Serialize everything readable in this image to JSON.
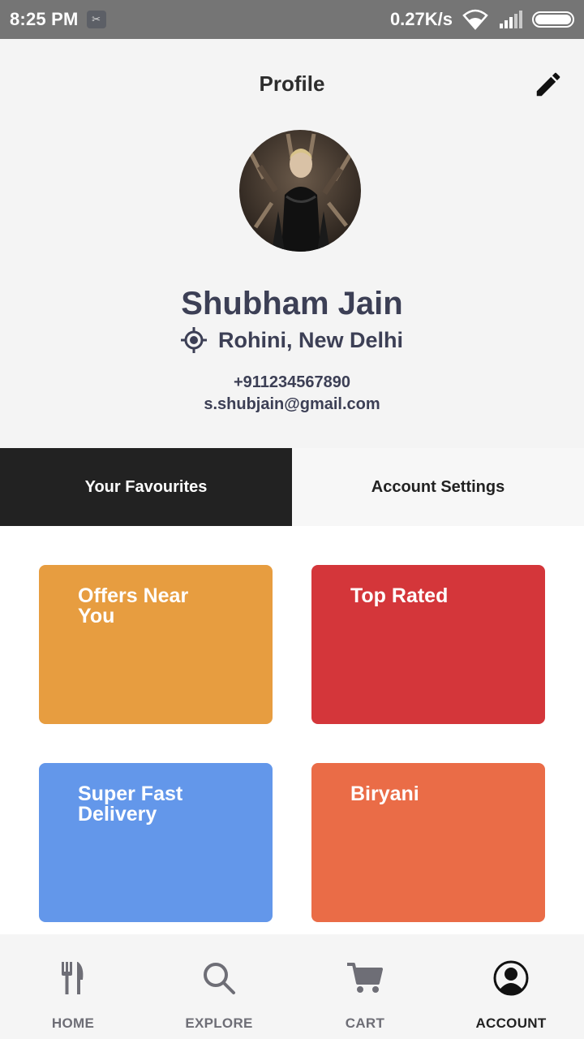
{
  "status_bar": {
    "time": "8:25 PM",
    "net_speed": "0.27K/s",
    "icons": [
      "notification-icon",
      "wifi-icon",
      "signal-icon",
      "battery-icon"
    ]
  },
  "header": {
    "title": "Profile",
    "edit_icon": "pencil-icon"
  },
  "profile": {
    "avatar": "avatar-photo",
    "name": "Shubham Jain",
    "location_icon": "location-target-icon",
    "location": "Rohini, New Delhi",
    "phone": "+911234567890",
    "email": "s.shubjain@gmail.com"
  },
  "tabs": [
    {
      "label": "Your Favourites",
      "active": true
    },
    {
      "label": "Account Settings",
      "active": false
    }
  ],
  "favourites": [
    {
      "label": "Offers Near You",
      "color": "#e79d40"
    },
    {
      "label": "Top Rated",
      "color": "#d4363a"
    },
    {
      "label": "Super Fast Delivery",
      "color": "#6397ea"
    },
    {
      "label": "Biryani",
      "color": "#ea6c47"
    }
  ],
  "bottom_nav": [
    {
      "label": "HOME",
      "icon": "fork-knife-icon",
      "active": false
    },
    {
      "label": "EXPLORE",
      "icon": "search-icon",
      "active": false
    },
    {
      "label": "CART",
      "icon": "cart-icon",
      "active": false
    },
    {
      "label": "ACCOUNT",
      "icon": "account-icon",
      "active": true
    }
  ],
  "colors": {
    "status_bar": "#757575",
    "header_bg": "#f4f4f4",
    "text_dark": "#3c3f55",
    "tab_active": "#222222",
    "nav_bg": "#f5f5f5"
  }
}
